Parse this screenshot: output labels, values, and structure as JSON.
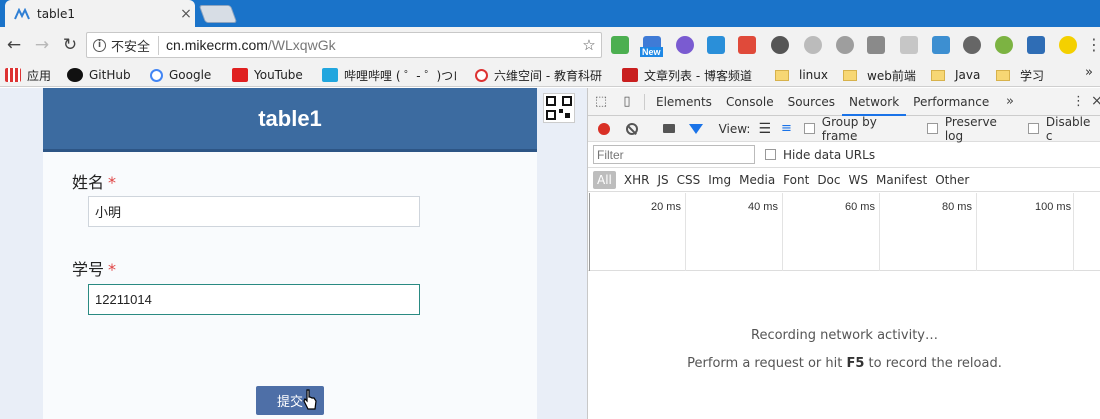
{
  "browser": {
    "tab_title": "table1",
    "tab_close": "×",
    "insecure_label": "不安全",
    "url_host": "cn.mikecrm.com",
    "url_path": "/WLxqwGk",
    "ext_new_badge": "New",
    "menu": "⋮"
  },
  "bookmarks": [
    {
      "label": "应用",
      "icon": "apps-icon"
    },
    {
      "label": "GitHub",
      "icon": "github-icon"
    },
    {
      "label": "Google",
      "icon": "google-icon"
    },
    {
      "label": "YouTube",
      "icon": "youtube-icon"
    },
    {
      "label": "哔哩哔哩 ( ゜- ゜)つロ",
      "icon": "bilibili-icon"
    },
    {
      "label": "六维空间 - 教育科研",
      "icon": "liuwei-icon"
    },
    {
      "label": "文章列表 - 博客频道",
      "icon": "csdn-icon"
    },
    {
      "label": "linux",
      "icon": "folder-icon"
    },
    {
      "label": "web前端",
      "icon": "folder-icon"
    },
    {
      "label": "Java",
      "icon": "folder-icon"
    },
    {
      "label": "学习",
      "icon": "folder-icon"
    }
  ],
  "bookmarks_more": "»",
  "form": {
    "title": "table1",
    "name_label": "姓名",
    "name_value": "小明",
    "id_label": "学号",
    "id_value": "12211014",
    "required_mark": "*",
    "submit_label": "提交"
  },
  "devtools": {
    "tabs": [
      "Elements",
      "Console",
      "Sources",
      "Network",
      "Performance"
    ],
    "active_tab": "Network",
    "more": "»",
    "view_label": "View:",
    "group_by_frame": "Group by frame",
    "preserve_log": "Preserve log",
    "disable_cache": "Disable c",
    "filter_placeholder": "Filter",
    "hide_data_urls": "Hide data URLs",
    "types": [
      "All",
      "XHR",
      "JS",
      "CSS",
      "Img",
      "Media",
      "Font",
      "Doc",
      "WS",
      "Manifest",
      "Other"
    ],
    "ticks": [
      "20 ms",
      "40 ms",
      "60 ms",
      "80 ms",
      "100 ms"
    ],
    "recording": "Recording network activity…",
    "perform_prefix": "Perform a request or hit ",
    "perform_key": "F5",
    "perform_suffix": " to record the reload."
  }
}
